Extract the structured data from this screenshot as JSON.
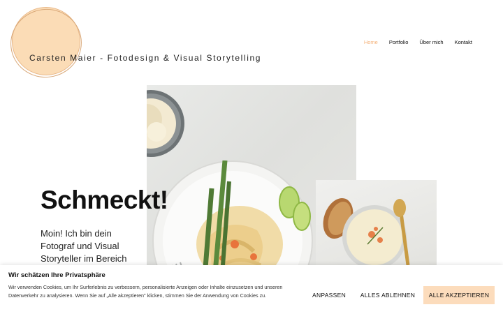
{
  "header": {
    "site_title": "Carsten Maier - Fotodesign & Visual Storytelling",
    "nav": [
      {
        "label": "Home",
        "active": true
      },
      {
        "label": "Portfolio",
        "active": false
      },
      {
        "label": "Über mich",
        "active": false
      },
      {
        "label": "Kontakt",
        "active": false
      }
    ]
  },
  "hero": {
    "title": "Schmeckt!",
    "text": "Moin! Ich bin dein Fotograf und Visual Storyteller im Bereich"
  },
  "cookie": {
    "title": "Wir schätzen Ihre Privatsphäre",
    "text": "Wir verwenden Cookies, um Ihr Surferlebnis zu verbessern, personalisierte Anzeigen oder Inhalte einzusetzen und unseren Datenverkehr zu analysieren. Wenn Sie auf „Alle akzeptieren\" klicken, stimmen Sie der Anwendung von Cookies zu.",
    "customize_label": "ANPASSEN",
    "reject_label": "ALLES ABLEHNEN",
    "accept_label": "ALLE AKZEPTIEREN"
  },
  "colors": {
    "accent": "#f4b27a",
    "logo_fill": "#fbdcb6",
    "accept_button": "#fcdcbc"
  }
}
